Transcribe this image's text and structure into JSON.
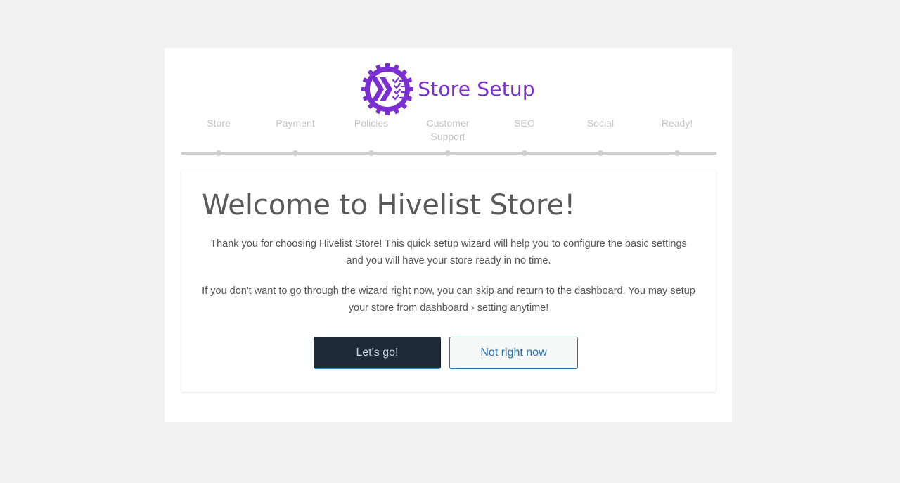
{
  "header": {
    "logo_icon": "gear-checklist-logo-icon",
    "title": "Store Setup",
    "brand_color": "#7b2fd1"
  },
  "steps": [
    {
      "label": "Store"
    },
    {
      "label": "Payment"
    },
    {
      "label": "Policies"
    },
    {
      "label": "Customer Support"
    },
    {
      "label": "SEO"
    },
    {
      "label": "Social"
    },
    {
      "label": "Ready!"
    }
  ],
  "content": {
    "title": "Welcome to Hivelist Store!",
    "paragraph_1": "Thank you for choosing Hivelist Store! This quick setup wizard will help you to configure the basic settings and you will have your store ready in no time.",
    "paragraph_2": "If you don't want to go through the wizard right now, you can skip and return to the dashboard. You may setup your store from dashboard › setting anytime!"
  },
  "buttons": {
    "primary_label": "Let's go!",
    "secondary_label": "Not right now"
  }
}
